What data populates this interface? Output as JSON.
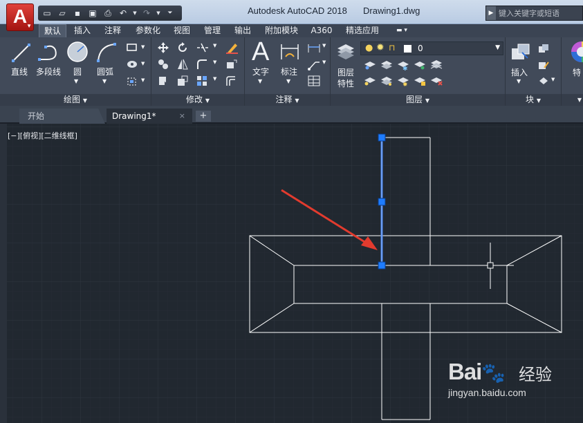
{
  "titlebar": {
    "app_letter": "A",
    "app_name": "Autodesk AutoCAD 2018",
    "file_name": "Drawing1.dwg",
    "search_placeholder": "键入关键字或短语"
  },
  "ribbon_tabs": [
    "默认",
    "插入",
    "注释",
    "参数化",
    "视图",
    "管理",
    "输出",
    "附加模块",
    "A360",
    "精选应用"
  ],
  "ribbon": {
    "draw": {
      "footer": "绘图",
      "line": "直线",
      "polyline": "多段线",
      "circle": "圆",
      "arc": "圆弧"
    },
    "modify": {
      "footer": "修改"
    },
    "annotation": {
      "footer": "注释",
      "text": "文字",
      "dimension": "标注"
    },
    "layers": {
      "footer": "图层",
      "props_line1": "图层",
      "props_line2": "特性",
      "current_layer": "0"
    },
    "block": {
      "footer": "块",
      "insert": "插入"
    },
    "properties": {
      "label_partial": "特"
    }
  },
  "filetabs": {
    "start": "开始",
    "drawing": "Drawing1*",
    "close": "×",
    "new": "+"
  },
  "canvas": {
    "view_label": "[−][俯视][二维线框]"
  },
  "watermark": {
    "main": "Bai",
    "suffix": "经验",
    "url": "jingyan.baidu.com"
  },
  "colors": {
    "canvas_bg": "#212830",
    "grid": "#2b323c",
    "line": "#ffffff",
    "selected": "#2f6fd6",
    "grip": "#1e7cff",
    "arrow": "#e23b2e"
  }
}
